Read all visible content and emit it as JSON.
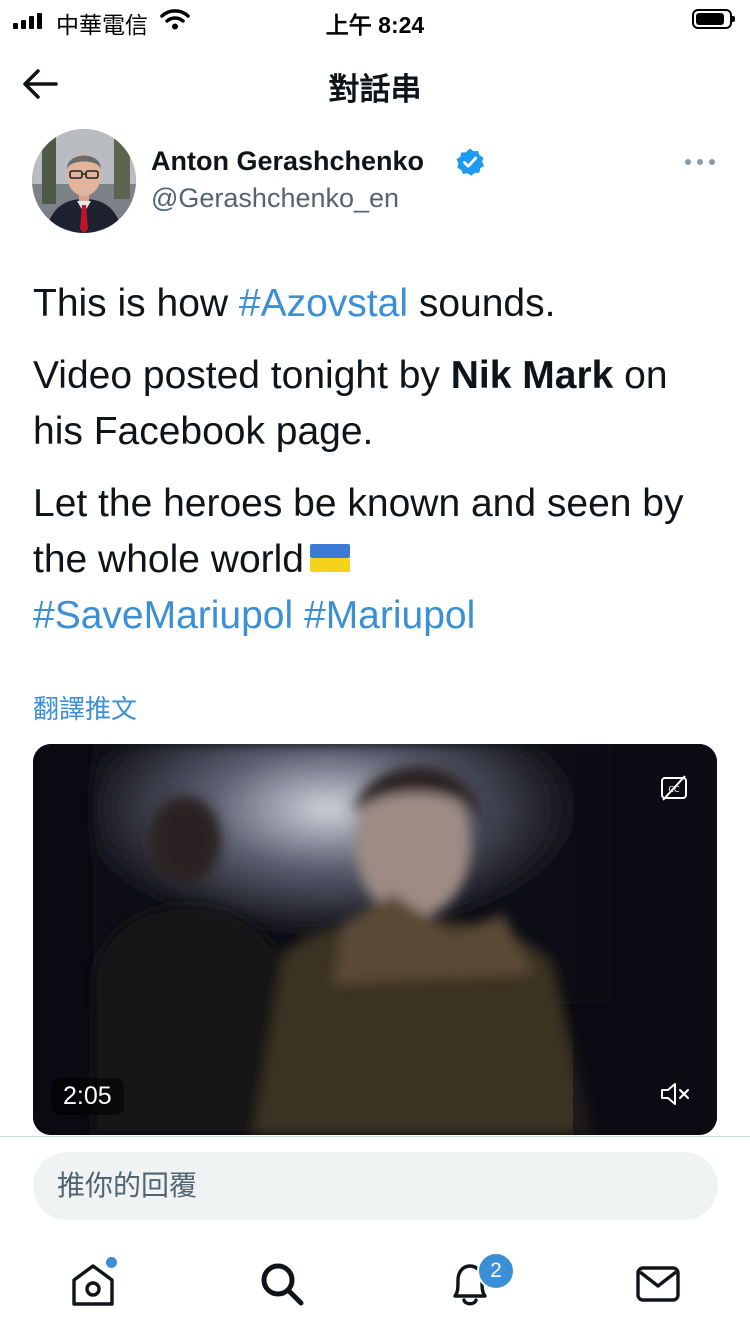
{
  "status_bar": {
    "carrier": "中華電信",
    "time": "上午 8:24"
  },
  "header": {
    "title": "對話串"
  },
  "tweet": {
    "author": {
      "name": "Anton Gerashchenko",
      "handle": "@Gerashchenko_en",
      "verified": true
    },
    "text": {
      "p1_before": "This is how ",
      "p1_hashtag": "#Azovstal",
      "p1_after": " sounds.",
      "p2_before": "Video posted tonight by ",
      "p2_bold": "Nik Mark",
      "p2_after": " on his Facebook page.",
      "p3": "Let the heroes be known and seen by the whole world",
      "hashtag_1": "#SaveMariupol",
      "hashtag_2": "#Mariupol"
    },
    "translate_label": "翻譯推文",
    "video": {
      "duration": "2:05"
    }
  },
  "reply": {
    "placeholder": "推你的回覆"
  },
  "tab_bar": {
    "notification_count": "2"
  },
  "colors": {
    "accent": "#3a8fd6",
    "text": "#0f1419",
    "secondary": "#536471",
    "verified": "#1d9bf0"
  },
  "icons": [
    "back-arrow-icon",
    "verified-badge-icon",
    "more-options-icon",
    "ukraine-flag-icon",
    "closed-captions-icon",
    "mute-icon",
    "home-icon",
    "search-icon",
    "notifications-icon",
    "messages-icon"
  ]
}
